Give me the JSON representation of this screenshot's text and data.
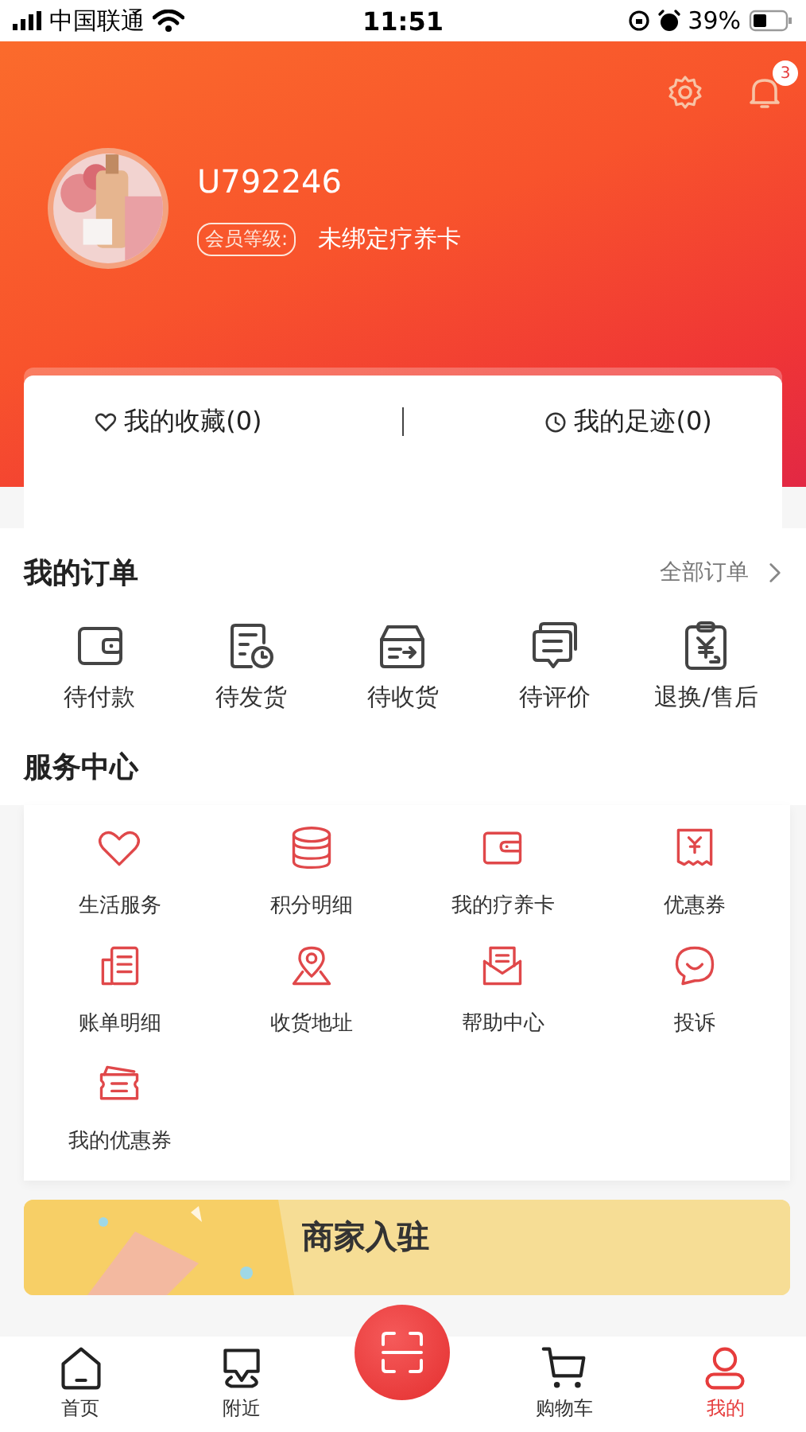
{
  "status_bar": {
    "carrier": "中国联通",
    "time": "11:51",
    "battery": "39%"
  },
  "header": {
    "notification_count": "3",
    "username": "U792246",
    "member_label": "会员等级:",
    "member_value": "未绑定疗养卡"
  },
  "quick_links": [
    {
      "label": "我的收藏(0)"
    },
    {
      "label": "我的足迹(0)"
    }
  ],
  "orders": {
    "title": "我的订单",
    "all_link": "全部订单",
    "items": [
      {
        "label": "待付款"
      },
      {
        "label": "待发货"
      },
      {
        "label": "待收货"
      },
      {
        "label": "待评价"
      },
      {
        "label": "退换/售后"
      }
    ]
  },
  "services": {
    "title": "服务中心",
    "items": [
      {
        "label": "生活服务"
      },
      {
        "label": "积分明细"
      },
      {
        "label": "我的疗养卡"
      },
      {
        "label": "优惠券"
      },
      {
        "label": "账单明细"
      },
      {
        "label": "收货地址"
      },
      {
        "label": "帮助中心"
      },
      {
        "label": "投诉"
      },
      {
        "label": "我的优惠券"
      }
    ]
  },
  "banner": {
    "title": "商家入驻"
  },
  "tab_bar": [
    {
      "kind": "tab",
      "label": "首页",
      "selected": false
    },
    {
      "kind": "tab",
      "label": "附近",
      "selected": false
    },
    {
      "kind": "scan"
    },
    {
      "kind": "tab",
      "label": "购物车",
      "selected": false
    },
    {
      "kind": "tab",
      "label": "我的",
      "selected": true
    }
  ]
}
